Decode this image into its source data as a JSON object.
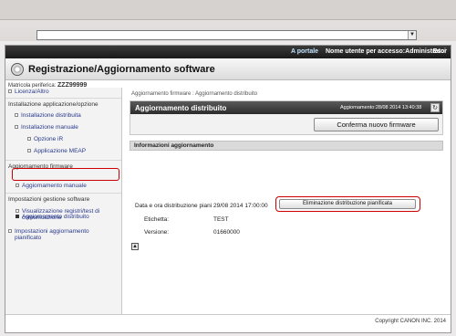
{
  "header": {
    "portal": "A portale",
    "user_label": "Nome utente per accesso:Administrator",
    "logout": "Esci",
    "app_title": "Registrazione/Aggiornamento software",
    "serial_label": "Matricola periferica:",
    "serial_value": "ZZZ99999"
  },
  "sidebar": {
    "items": [
      {
        "label": "Licenza/Altro"
      },
      {
        "label": "Installazione applicazione/opzione"
      },
      {
        "label": "Installazione distribuita"
      },
      {
        "label": "Installazione manuale"
      },
      {
        "label": "Opzione iR"
      },
      {
        "label": "Applicazione MEAP"
      },
      {
        "label": "Aggiornamento firmware"
      },
      {
        "label": "Aggiornamento distribuito"
      },
      {
        "label": "Aggiornamento manuale"
      },
      {
        "label": "Impostazioni gestione software"
      },
      {
        "label": "Visualizzazione registri/test di"
      },
      {
        "label": "comunicazione"
      },
      {
        "label": "Impostazioni aggiornamento"
      },
      {
        "label": "pianificato"
      }
    ]
  },
  "main": {
    "breadcrumb": "Aggiornamento firmware : Aggiornamento distribuito",
    "section_title": "Aggiornamento distribuito",
    "updated": "Aggiornamento:28/08 2014 13:40:38",
    "confirm_button": "Conferma nuovo firmware",
    "info_title": "Informazioni aggiornamento",
    "date_label": "Data e ora distribuzione piani",
    "date_value": "29/08 2014 17:00:00",
    "delete_button": "Eliminazione distribuzione pianificata",
    "tag_label": "Etichetta:",
    "tag_value": "TEST",
    "version_label": "Versione:",
    "version_value": "01660000"
  },
  "footer": {
    "copyright": "Copyright CANON INC. 2014"
  },
  "colors": {
    "highlight": "#cc0000",
    "link": "#2a3a8c",
    "header_dark": "#2c2c2c"
  }
}
